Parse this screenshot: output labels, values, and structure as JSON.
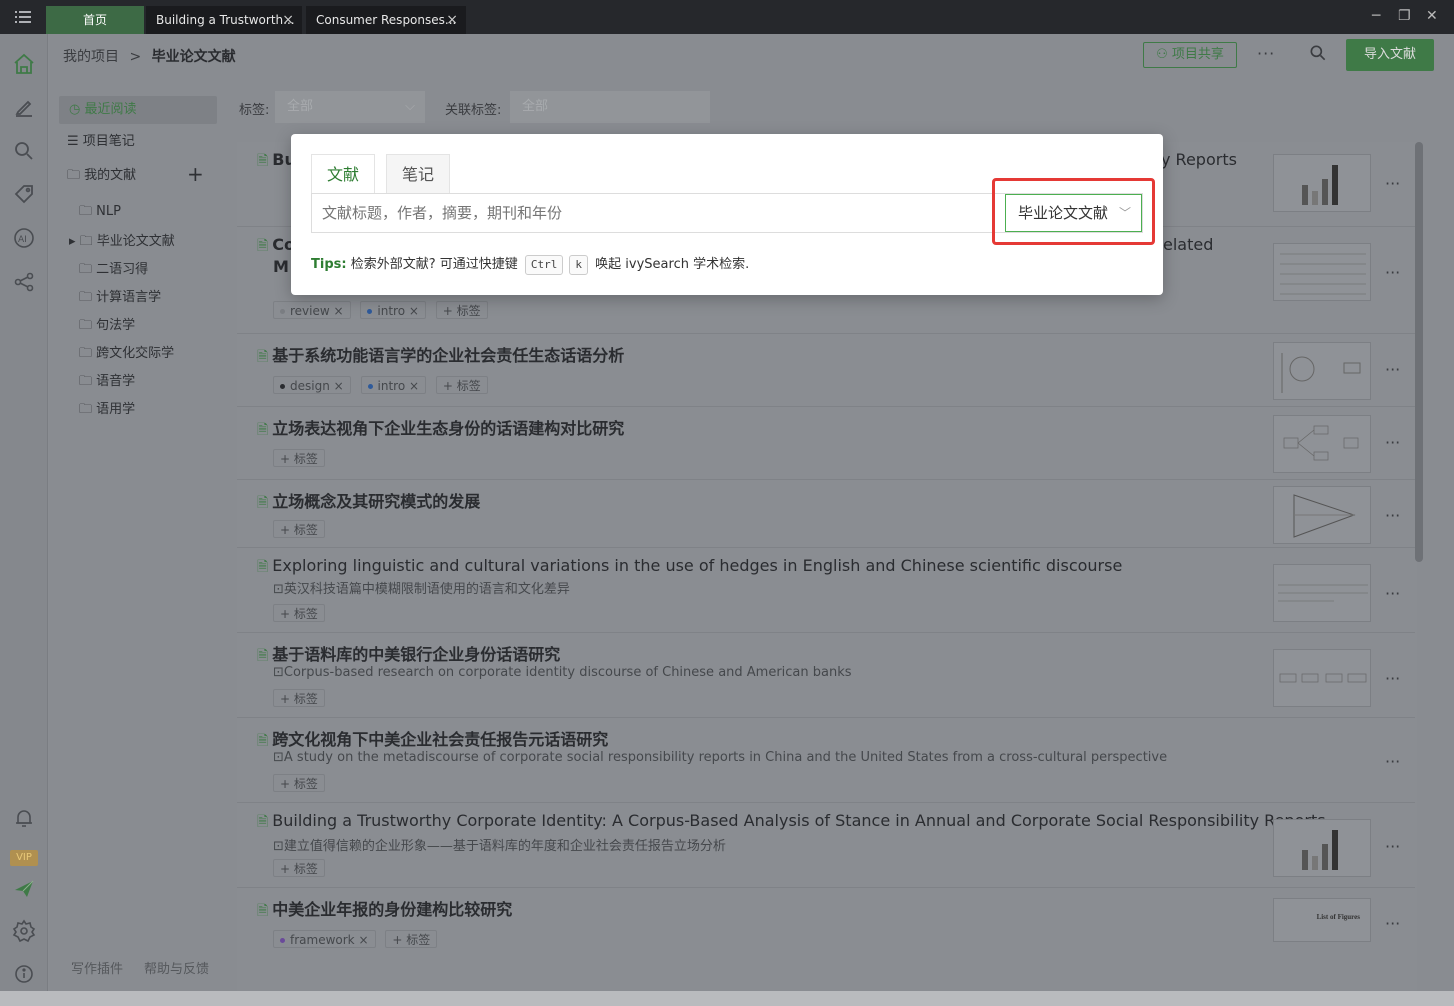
{
  "titlebar": {
    "tabs": [
      {
        "label": "首页"
      },
      {
        "label": "Building a Trustworth..."
      },
      {
        "label": "Consumer Responses..."
      }
    ],
    "close_glyph": "×"
  },
  "header": {
    "breadcrumb_root": "我的项目",
    "breadcrumb_sep": ">",
    "breadcrumb_current": "毕业论文文献",
    "share_label": "项目共享",
    "more_label": "···",
    "import_label": "导入文献"
  },
  "sidebar": {
    "recent": "最近阅读",
    "notes": "项目笔记",
    "my_docs": "我的文献",
    "add_glyph": "+",
    "folders": [
      "NLP",
      "毕业论文文献",
      "二语习得",
      "计算语言学",
      "句法学",
      "跨文化交际学",
      "语音学",
      "语用学"
    ],
    "footer_plugin": "写作插件",
    "footer_help": "帮助与反馈",
    "vip": "VIP"
  },
  "filters": {
    "tag_label": "标签:",
    "tag_value": "全部",
    "rel_label": "关联标签:",
    "rel_value": "全部"
  },
  "list": {
    "add_tag": "+ 标签",
    "more": "···",
    "cards": [
      {
        "title_visible": "Bu",
        "title_right": "y Reports"
      },
      {
        "title_visible": "Co",
        "title_line2": "M",
        "title_right": "elated",
        "tags": [
          "review",
          "intro"
        ]
      },
      {
        "title": "基于系统功能语言学的企业社会责任生态话语分析",
        "tags": [
          "design",
          "intro"
        ]
      },
      {
        "title": "立场表达视角下企业生态身份的话语建构对比研究"
      },
      {
        "title": "立场概念及其研究模式的发展"
      },
      {
        "title": "Exploring linguistic and cultural variations in the use of hedges in English and Chinese scientific discourse",
        "sub": "英汉科技语篇中模糊限制语使用的语言和文化差异"
      },
      {
        "title": "基于语料库的中美银行企业身份话语研究",
        "sub": "Corpus-based research on corporate identity discourse of Chinese and American banks"
      },
      {
        "title": "跨文化视角下中美企业社会责任报告元话语研究",
        "sub": "A study on the metadiscourse of corporate social responsibility reports in China and the United States from a cross-cultural perspective"
      },
      {
        "title": "Building a Trustworthy Corporate Identity: A Corpus-Based Analysis of Stance in Annual and Corporate Social Responsibility Reports",
        "sub": "建立值得信赖的企业形象——基于语料库的年度和企业社会责任报告立场分析"
      },
      {
        "title": "中美企业年报的身份建构比较研究",
        "tags": [
          "framework"
        ]
      }
    ],
    "thumb_caption": "List of Figures"
  },
  "modal": {
    "tab_docs": "文献",
    "tab_notes": "笔记",
    "search_placeholder": "文献标题，作者，摘要，期刊和年份",
    "scope_value": "毕业论文文献",
    "tips_label": "Tips:",
    "tips_text": "检索外部文献? 可通过快捷键",
    "key1": "Ctrl",
    "key2": "k",
    "tips_tail": "唤起 ivySearch 学术检索."
  },
  "colors": {
    "accent": "#3f7a47",
    "highlight": "#e53935",
    "overlay": "#8a8d92"
  }
}
